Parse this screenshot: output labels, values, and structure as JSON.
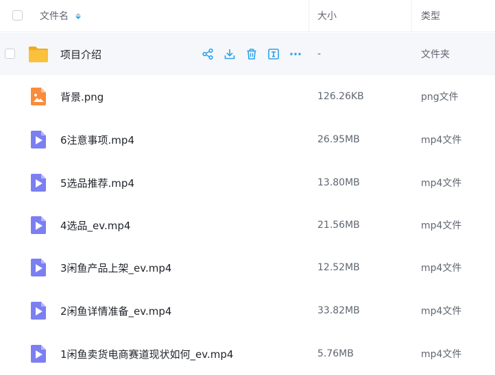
{
  "header": {
    "name_label": "文件名",
    "size_label": "大小",
    "type_label": "类型"
  },
  "files": [
    {
      "name": "项目介绍",
      "size": "-",
      "type": "文件夹",
      "icon": "folder-icon"
    },
    {
      "name": "背景.png",
      "size": "126.26KB",
      "type": "png文件",
      "icon": "image-file-icon"
    },
    {
      "name": "6注意事项.mp4",
      "size": "26.95MB",
      "type": "mp4文件",
      "icon": "video-file-icon"
    },
    {
      "name": "5选品推荐.mp4",
      "size": "13.80MB",
      "type": "mp4文件",
      "icon": "video-file-icon"
    },
    {
      "name": "4选品_ev.mp4",
      "size": "21.56MB",
      "type": "mp4文件",
      "icon": "video-file-icon"
    },
    {
      "name": "3闲鱼产品上架_ev.mp4",
      "size": "12.52MB",
      "type": "mp4文件",
      "icon": "video-file-icon"
    },
    {
      "name": "2闲鱼详情准备_ev.mp4",
      "size": "33.82MB",
      "type": "mp4文件",
      "icon": "video-file-icon"
    },
    {
      "name": "1闲鱼卖货电商赛道现状如何_ev.mp4",
      "size": "5.76MB",
      "type": "mp4文件",
      "icon": "video-file-icon"
    }
  ],
  "row_actions": [
    "share-icon",
    "download-icon",
    "delete-icon",
    "rename-icon",
    "more-icon"
  ],
  "colors": {
    "accent": "#2aa1ea",
    "folder": "#f9c13c",
    "image_file": "#f98c3c",
    "video_file": "#7c7ff2",
    "selected_row": "#f5f7fa"
  }
}
